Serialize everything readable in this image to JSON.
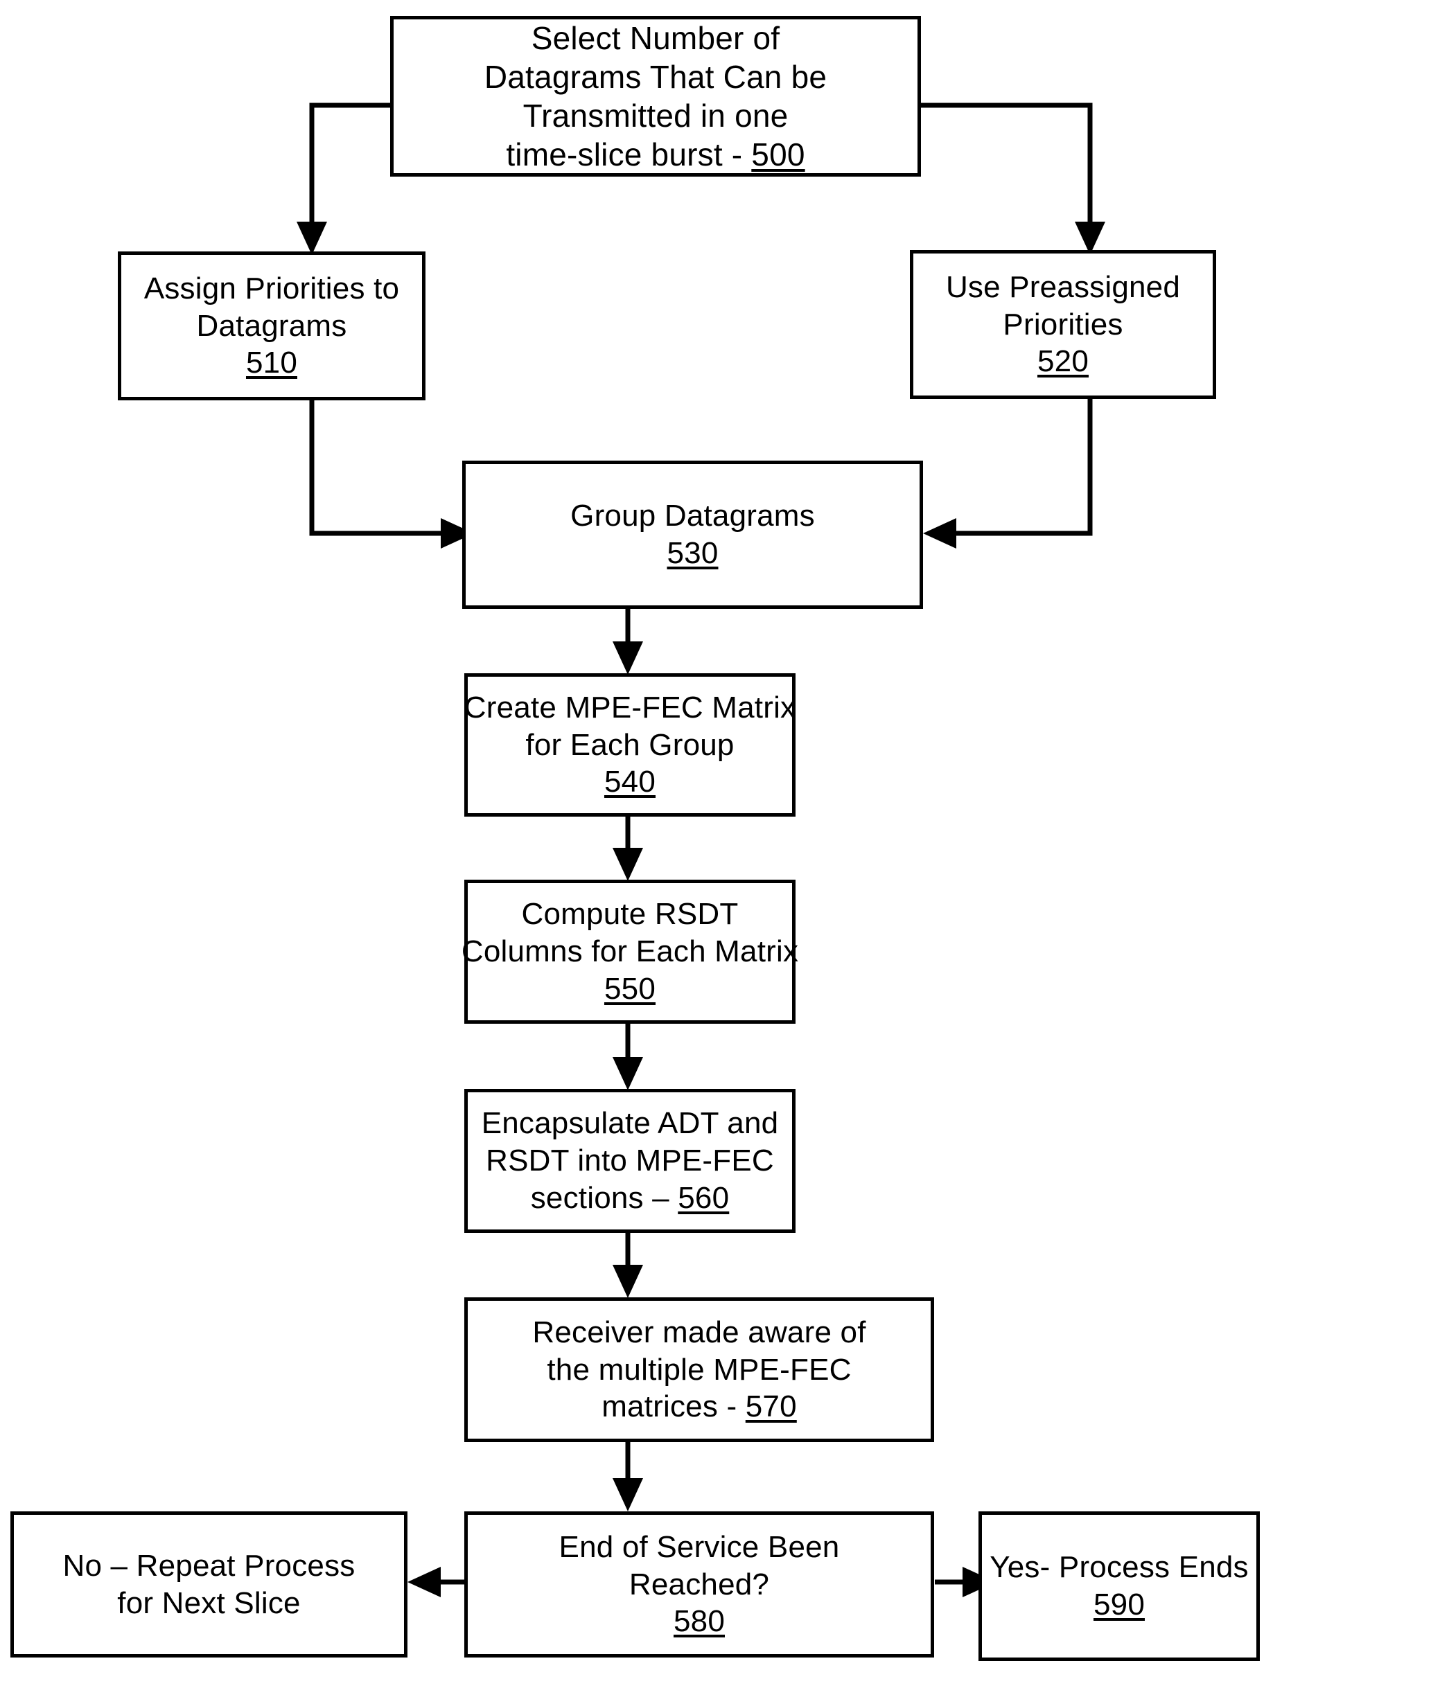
{
  "diagram": {
    "title": "MPE-FEC multi-matrix transmission process flowchart",
    "line_color": "#000000",
    "background_color": "#ffffff"
  },
  "nodes": {
    "n500": {
      "id": "500",
      "lines": [
        "Select Number of",
        "Datagrams That Can be",
        "Transmitted in one",
        "time-slice burst - "
      ],
      "ref": "500",
      "ref_inline": true,
      "text": "Select Number of Datagrams That Can be Transmitted in one time-slice burst - 500"
    },
    "n510": {
      "id": "510",
      "lines": [
        "Assign Priorities to",
        "Datagrams"
      ],
      "ref": "510",
      "ref_inline": false,
      "text": "Assign Priorities to Datagrams 510"
    },
    "n520": {
      "id": "520",
      "lines": [
        "Use Preassigned",
        "Priorities"
      ],
      "ref": "520",
      "ref_inline": false,
      "text": "Use Preassigned Priorities 520"
    },
    "n530": {
      "id": "530",
      "lines": [
        "Group Datagrams"
      ],
      "ref": "530",
      "ref_inline": false,
      "text": "Group Datagrams 530"
    },
    "n540": {
      "id": "540",
      "lines": [
        "Create MPE-FEC Matrix",
        "for Each Group"
      ],
      "ref": "540",
      "ref_inline": false,
      "text": "Create MPE-FEC Matrix for Each Group 540"
    },
    "n550": {
      "id": "550",
      "lines": [
        "Compute RSDT",
        "Columns for Each Matrix"
      ],
      "ref": "550",
      "ref_inline": false,
      "text": "Compute RSDT Columns for Each Matrix 550"
    },
    "n560": {
      "id": "560",
      "lines": [
        "Encapsulate ADT and",
        "RSDT into MPE-FEC",
        "sections – "
      ],
      "ref": "560",
      "ref_inline": true,
      "text": "Encapsulate ADT and RSDT into MPE-FEC sections – 560"
    },
    "n570": {
      "id": "570",
      "lines": [
        "Receiver made aware of",
        "the multiple MPE-FEC",
        "matrices - "
      ],
      "ref": "570",
      "ref_inline": true,
      "text": "Receiver made aware of the multiple MPE-FEC matrices - 570"
    },
    "n580": {
      "id": "580",
      "lines": [
        "End of Service Been",
        "Reached?"
      ],
      "ref": "580",
      "ref_inline": false,
      "text": "End of Service Been Reached? 580"
    },
    "n_no": {
      "id": "no-branch",
      "lines": [
        "No – Repeat Process",
        "for Next Slice"
      ],
      "ref": "",
      "ref_inline": false,
      "text": "No – Repeat Process for Next Slice"
    },
    "n590": {
      "id": "590",
      "lines": [
        "Yes- Process Ends"
      ],
      "ref": "590",
      "ref_inline": false,
      "text": "Yes- Process Ends 590"
    }
  },
  "edges": [
    {
      "name": "edge-500-to-510",
      "from": "500",
      "to": "510",
      "label": ""
    },
    {
      "name": "edge-500-to-520",
      "from": "500",
      "to": "520",
      "label": ""
    },
    {
      "name": "edge-510-to-530",
      "from": "510",
      "to": "530",
      "label": ""
    },
    {
      "name": "edge-520-to-530",
      "from": "520",
      "to": "530",
      "label": ""
    },
    {
      "name": "edge-530-to-540",
      "from": "530",
      "to": "540",
      "label": ""
    },
    {
      "name": "edge-540-to-550",
      "from": "540",
      "to": "550",
      "label": ""
    },
    {
      "name": "edge-550-to-560",
      "from": "550",
      "to": "560",
      "label": ""
    },
    {
      "name": "edge-560-to-570",
      "from": "560",
      "to": "570",
      "label": ""
    },
    {
      "name": "edge-570-to-580",
      "from": "570",
      "to": "580",
      "label": ""
    },
    {
      "name": "edge-580-to-no",
      "from": "580",
      "to": "no-branch",
      "label": ""
    },
    {
      "name": "edge-580-to-590",
      "from": "580",
      "to": "590",
      "label": ""
    }
  ]
}
